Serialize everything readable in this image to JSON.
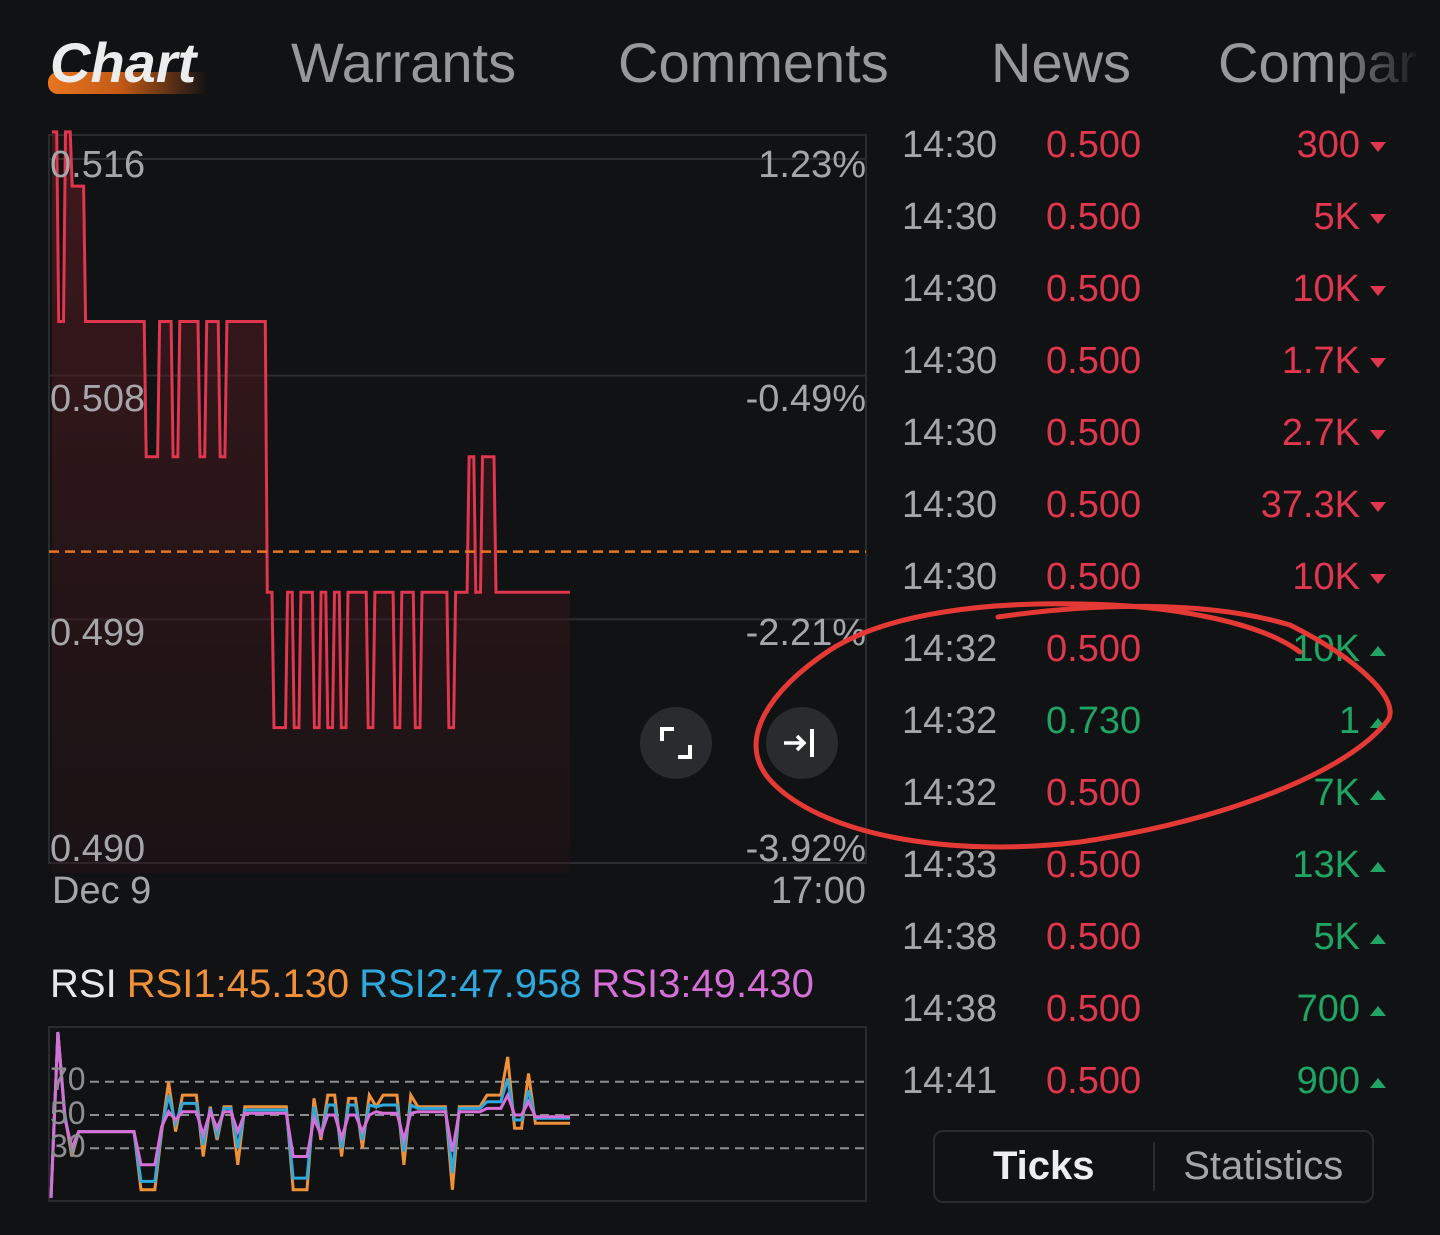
{
  "tabs": [
    {
      "label": "Chart",
      "active": true
    },
    {
      "label": "Warrants",
      "active": false
    },
    {
      "label": "Comments",
      "active": false
    },
    {
      "label": "News",
      "active": false
    },
    {
      "label": "Company",
      "active": false,
      "visible_text": "Compar"
    }
  ],
  "colors": {
    "background": "#111214",
    "down": "#e0364e",
    "up": "#1fa463",
    "accent": "#e8751f",
    "rsi1": "#f0913a",
    "rsi2": "#2fa8dc",
    "rsi3": "#d66fd8",
    "annotation": "#e53935"
  },
  "chart_data": [
    {
      "type": "line",
      "name": "intraday-price",
      "title": "",
      "y_left_ticks": [
        "0.516",
        "0.508",
        "0.499",
        "0.490"
      ],
      "y_right_ticks": [
        "1.23%",
        "-0.49%",
        "-2.21%",
        "-3.92%"
      ],
      "x_ticks": [
        "Dec 9",
        "17:00"
      ],
      "ylim": [
        0.49,
        0.516
      ],
      "previous_close": 0.5015,
      "series": [
        {
          "name": "price",
          "x": [
            0,
            1,
            2,
            3,
            4,
            5,
            6,
            7,
            8,
            9,
            10,
            11,
            12,
            13,
            14,
            15,
            16,
            17,
            18,
            19,
            20,
            21,
            22,
            23,
            24,
            25,
            26,
            27,
            28,
            29,
            30,
            31,
            32,
            33,
            34,
            35,
            36,
            37,
            38,
            39,
            40,
            41,
            42,
            43,
            44,
            45,
            46,
            47,
            48,
            49,
            50,
            51,
            52,
            53,
            54,
            55,
            56,
            57,
            58,
            59,
            60,
            61,
            62,
            63,
            64,
            65,
            66,
            67,
            68,
            69,
            70,
            71,
            72,
            73,
            74,
            75,
            76,
            77
          ],
          "y": [
            0.517,
            0.51,
            0.517,
            0.515,
            0.515,
            0.51,
            0.51,
            0.51,
            0.51,
            0.51,
            0.51,
            0.51,
            0.51,
            0.51,
            0.505,
            0.505,
            0.51,
            0.51,
            0.505,
            0.51,
            0.51,
            0.51,
            0.505,
            0.51,
            0.51,
            0.505,
            0.51,
            0.51,
            0.51,
            0.51,
            0.51,
            0.51,
            0.5,
            0.495,
            0.495,
            0.5,
            0.495,
            0.5,
            0.5,
            0.495,
            0.5,
            0.495,
            0.5,
            0.495,
            0.5,
            0.5,
            0.5,
            0.495,
            0.5,
            0.5,
            0.5,
            0.495,
            0.5,
            0.5,
            0.495,
            0.5,
            0.5,
            0.5,
            0.5,
            0.495,
            0.5,
            0.5,
            0.505,
            0.5,
            0.505,
            0.505,
            0.5,
            0.5,
            0.5,
            0.5,
            0.5,
            0.5,
            0.5,
            0.5,
            0.5,
            0.5,
            0.5,
            0.5
          ]
        }
      ],
      "controls": [
        {
          "name": "fullscreen",
          "icon": "expand-corners-icon"
        },
        {
          "name": "scroll-to-latest",
          "icon": "arrow-to-end-icon"
        }
      ]
    },
    {
      "type": "line",
      "name": "rsi-indicator",
      "title": "RSI",
      "y_ticks": [
        "70",
        "50",
        "30"
      ],
      "ylim": [
        0,
        100
      ],
      "legend": [
        {
          "label": "RSI1:45.130",
          "name": "RSI1",
          "value": 45.13
        },
        {
          "label": "RSI2:47.958",
          "name": "RSI2",
          "value": 47.958
        },
        {
          "label": "RSI3:49.430",
          "name": "RSI3",
          "value": 49.43
        }
      ],
      "series": [
        {
          "name": "RSI1",
          "values": [
            0,
            100,
            50,
            25,
            40,
            40,
            40,
            40,
            40,
            40,
            40,
            40,
            40,
            5,
            5,
            5,
            40,
            70,
            40,
            62,
            62,
            62,
            25,
            55,
            35,
            55,
            55,
            20,
            55,
            55,
            55,
            55,
            55,
            55,
            55,
            5,
            5,
            5,
            60,
            35,
            62,
            62,
            25,
            60,
            60,
            30,
            62,
            55,
            62,
            62,
            62,
            20,
            62,
            55,
            55,
            55,
            55,
            55,
            5,
            55,
            55,
            55,
            55,
            62,
            62,
            62,
            85,
            42,
            42,
            75,
            45,
            45,
            45,
            45,
            45,
            45
          ]
        },
        {
          "name": "RSI2",
          "values": [
            0,
            100,
            50,
            28,
            40,
            40,
            40,
            40,
            40,
            40,
            40,
            40,
            40,
            10,
            10,
            10,
            42,
            62,
            45,
            57,
            57,
            57,
            32,
            54,
            38,
            54,
            54,
            30,
            53,
            53,
            53,
            53,
            53,
            53,
            53,
            12,
            12,
            12,
            55,
            37,
            56,
            56,
            30,
            56,
            56,
            35,
            56,
            55,
            56,
            56,
            56,
            28,
            56,
            54,
            54,
            54,
            54,
            54,
            15,
            54,
            54,
            54,
            54,
            58,
            58,
            58,
            72,
            47,
            47,
            65,
            48,
            48,
            48,
            48,
            48,
            48
          ]
        },
        {
          "name": "RSI3",
          "values": [
            0,
            100,
            48,
            30,
            40,
            40,
            40,
            40,
            40,
            40,
            40,
            40,
            40,
            20,
            20,
            20,
            43,
            52,
            47,
            52,
            52,
            52,
            38,
            52,
            42,
            52,
            52,
            40,
            51,
            51,
            51,
            51,
            51,
            51,
            51,
            25,
            25,
            25,
            48,
            38,
            50,
            50,
            36,
            50,
            50,
            40,
            50,
            52,
            51,
            51,
            51,
            35,
            51,
            52,
            52,
            52,
            52,
            52,
            28,
            52,
            52,
            52,
            52,
            54,
            54,
            54,
            62,
            50,
            50,
            58,
            49,
            49,
            49,
            49,
            49,
            49
          ]
        }
      ]
    }
  ],
  "ticks": {
    "rows": [
      {
        "time": "14:30",
        "price": "0.500",
        "price_dir": "down",
        "volume": "300",
        "side": "down"
      },
      {
        "time": "14:30",
        "price": "0.500",
        "price_dir": "down",
        "volume": "5K",
        "side": "down"
      },
      {
        "time": "14:30",
        "price": "0.500",
        "price_dir": "down",
        "volume": "10K",
        "side": "down"
      },
      {
        "time": "14:30",
        "price": "0.500",
        "price_dir": "down",
        "volume": "1.7K",
        "side": "down"
      },
      {
        "time": "14:30",
        "price": "0.500",
        "price_dir": "down",
        "volume": "2.7K",
        "side": "down"
      },
      {
        "time": "14:30",
        "price": "0.500",
        "price_dir": "down",
        "volume": "37.3K",
        "side": "down"
      },
      {
        "time": "14:30",
        "price": "0.500",
        "price_dir": "down",
        "volume": "10K",
        "side": "down"
      },
      {
        "time": "14:32",
        "price": "0.500",
        "price_dir": "down",
        "volume": "10K",
        "side": "up"
      },
      {
        "time": "14:32",
        "price": "0.730",
        "price_dir": "up",
        "volume": "1",
        "side": "up"
      },
      {
        "time": "14:32",
        "price": "0.500",
        "price_dir": "down",
        "volume": "7K",
        "side": "up"
      },
      {
        "time": "14:33",
        "price": "0.500",
        "price_dir": "down",
        "volume": "13K",
        "side": "up"
      },
      {
        "time": "14:38",
        "price": "0.500",
        "price_dir": "down",
        "volume": "5K",
        "side": "up"
      },
      {
        "time": "14:38",
        "price": "0.500",
        "price_dir": "down",
        "volume": "700",
        "side": "up"
      },
      {
        "time": "14:41",
        "price": "0.500",
        "price_dir": "down",
        "volume": "900",
        "side": "up"
      }
    ]
  },
  "bottom_toggle": {
    "options": [
      {
        "label": "Ticks",
        "active": true
      },
      {
        "label": "Statistics",
        "active": false
      }
    ]
  },
  "annotation": {
    "shape": "hand-drawn red ellipse",
    "highlights": "14:32 trades rows and scroll-to-latest button"
  }
}
